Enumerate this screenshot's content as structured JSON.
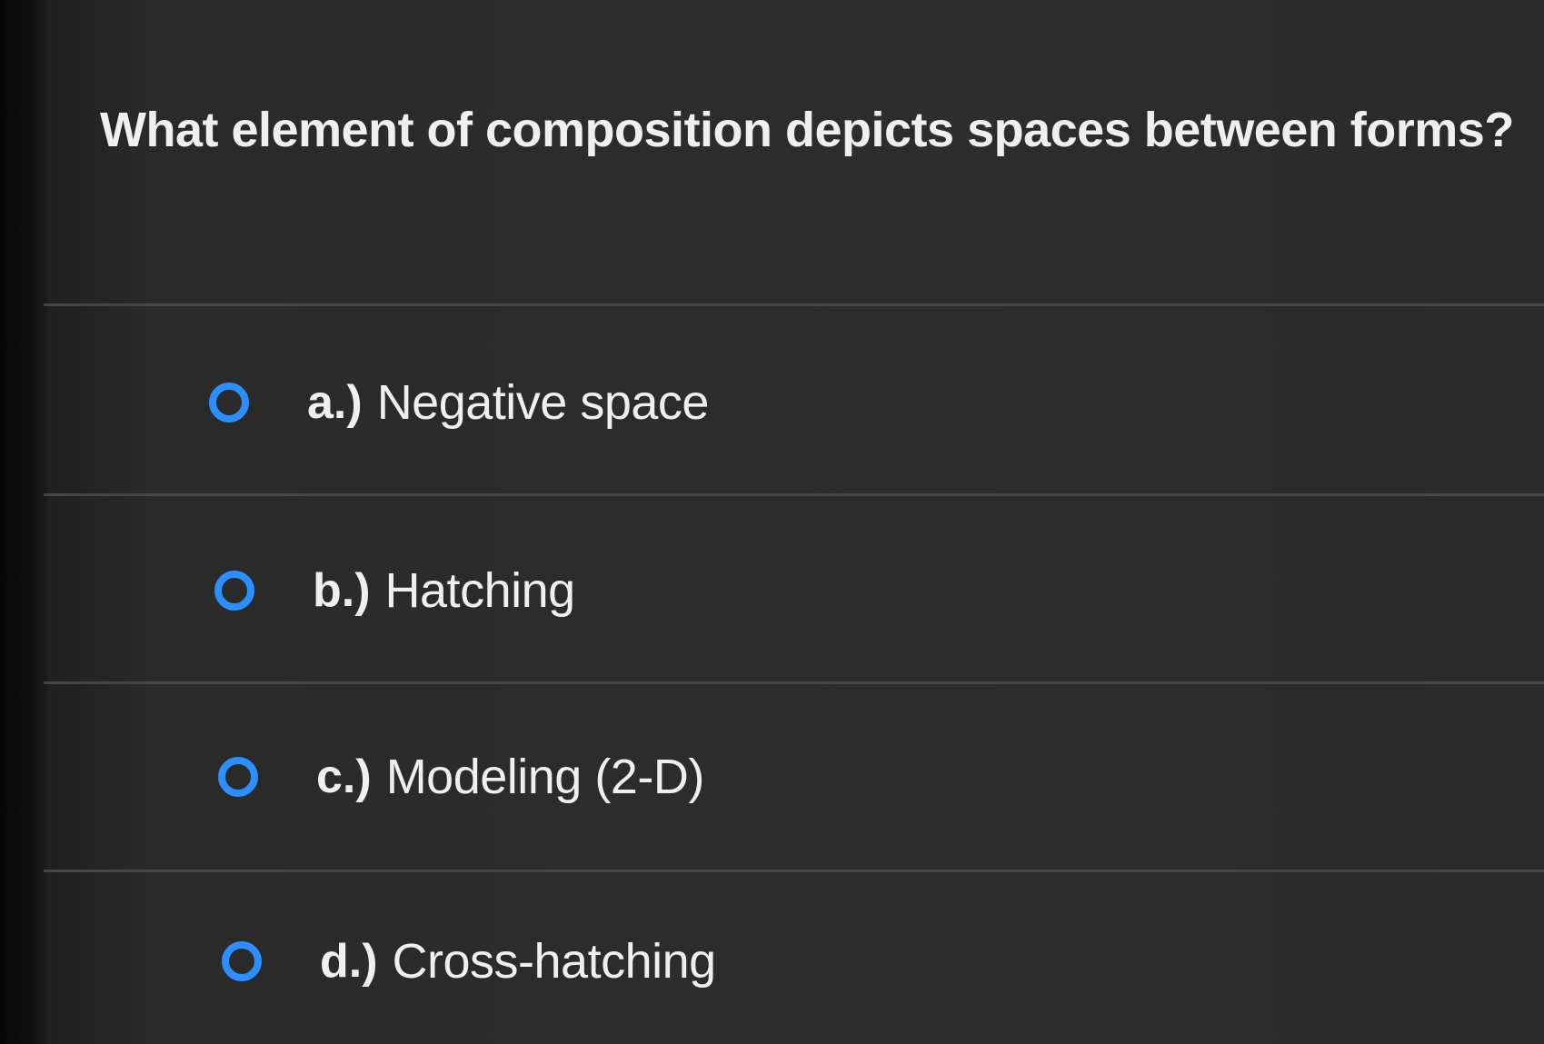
{
  "question": {
    "text": "What element of composition depicts spaces between forms?"
  },
  "options": [
    {
      "letter": "a.)",
      "text": "Negative space",
      "selected": false,
      "icon": "radio-unchecked-icon"
    },
    {
      "letter": "b.)",
      "text": "Hatching",
      "selected": false,
      "icon": "radio-unchecked-icon"
    },
    {
      "letter": "c.)",
      "text": "Modeling (2-D)",
      "selected": false,
      "icon": "radio-unchecked-icon"
    },
    {
      "letter": "d.)",
      "text": "Cross-hatching",
      "selected": false,
      "icon": "radio-unchecked-icon"
    }
  ],
  "colors": {
    "background": "#2d2d2d",
    "text": "#efefef",
    "radio_accent": "#2b8fff",
    "divider": "#464646"
  }
}
